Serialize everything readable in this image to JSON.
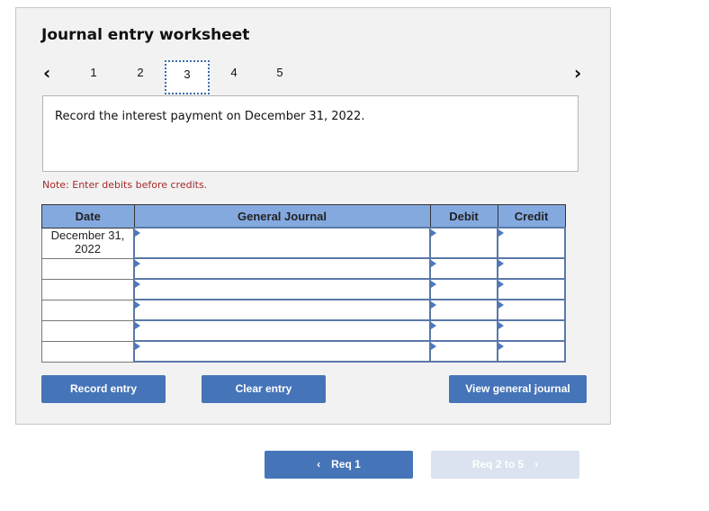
{
  "worksheet": {
    "title": "Journal entry worksheet",
    "prev_icon": "chevron-left-icon",
    "next_icon": "chevron-right-icon",
    "steps": [
      "1",
      "2",
      "3",
      "4",
      "5"
    ],
    "active_step": "3",
    "prompt": "Record the interest payment on December 31, 2022.",
    "note": "Note: Enter debits before credits."
  },
  "table": {
    "headers": {
      "date": "Date",
      "journal": "General Journal",
      "debit": "Debit",
      "credit": "Credit"
    },
    "rows": [
      {
        "date": "December 31,\n2022",
        "account": "",
        "debit": "",
        "credit": ""
      },
      {
        "date": "",
        "account": "",
        "debit": "",
        "credit": ""
      },
      {
        "date": "",
        "account": "",
        "debit": "",
        "credit": ""
      },
      {
        "date": "",
        "account": "",
        "debit": "",
        "credit": ""
      },
      {
        "date": "",
        "account": "",
        "debit": "",
        "credit": ""
      },
      {
        "date": "",
        "account": "",
        "debit": "",
        "credit": ""
      }
    ]
  },
  "buttons": {
    "record": "Record entry",
    "clear": "Clear entry",
    "view": "View general journal"
  },
  "footer_nav": {
    "prev_label": "Req 1",
    "next_label": "Req 2 to 5",
    "prev_icon": "chevron-left-icon",
    "next_icon": "chevron-right-icon",
    "next_disabled": true
  },
  "colors": {
    "accent": "#4674b8",
    "header_bg": "#84a9df",
    "note": "#a52a2a",
    "disabled": "#dae3ef"
  }
}
